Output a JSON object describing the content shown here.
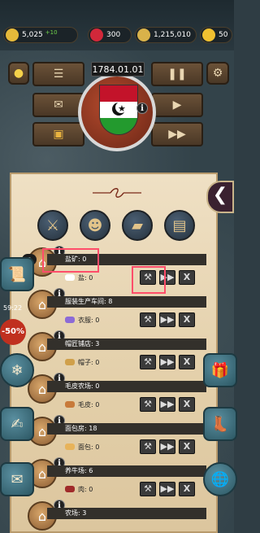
{
  "resources": {
    "gold": "5,025",
    "gold_delta": "+10",
    "gems": "300",
    "population": "1,215,010",
    "stars": "50"
  },
  "date": "1784.01.01",
  "badge_count": "8",
  "timer": "59:22",
  "sale_label": "-50%",
  "rows": [
    {
      "title": "盐矿: 0",
      "product": "盐: 0",
      "product_color": "#ffffff",
      "icon": "mine-icon"
    },
    {
      "title": "服装生产车间: 8",
      "product": "衣服: 0",
      "product_color": "#8c6bd6",
      "icon": "factory-icon"
    },
    {
      "title": "帽匠铺店: 3",
      "product": "帽子: 0",
      "product_color": "#d0a04a",
      "icon": "hat-shop-icon"
    },
    {
      "title": "毛皮农场: 0",
      "product": "毛皮: 0",
      "product_color": "#c87a3a",
      "icon": "fur-farm-icon"
    },
    {
      "title": "面包房: 18",
      "product": "面包: 0",
      "product_color": "#e7b35a",
      "icon": "bakery-icon"
    },
    {
      "title": "养牛场: 6",
      "product": "肉: 0",
      "product_color": "#a02a2a",
      "icon": "cattle-farm-icon"
    },
    {
      "title": "农场: 3",
      "product": "",
      "product_color": "#6a9a3a",
      "icon": "farm-icon"
    }
  ],
  "buttons": {
    "build": "⚒",
    "forward": "▶▶",
    "close": "X",
    "pause": "❚❚",
    "play": "▶",
    "fast": "▶▶",
    "menu": "☰",
    "back": "❮",
    "info": "i"
  }
}
